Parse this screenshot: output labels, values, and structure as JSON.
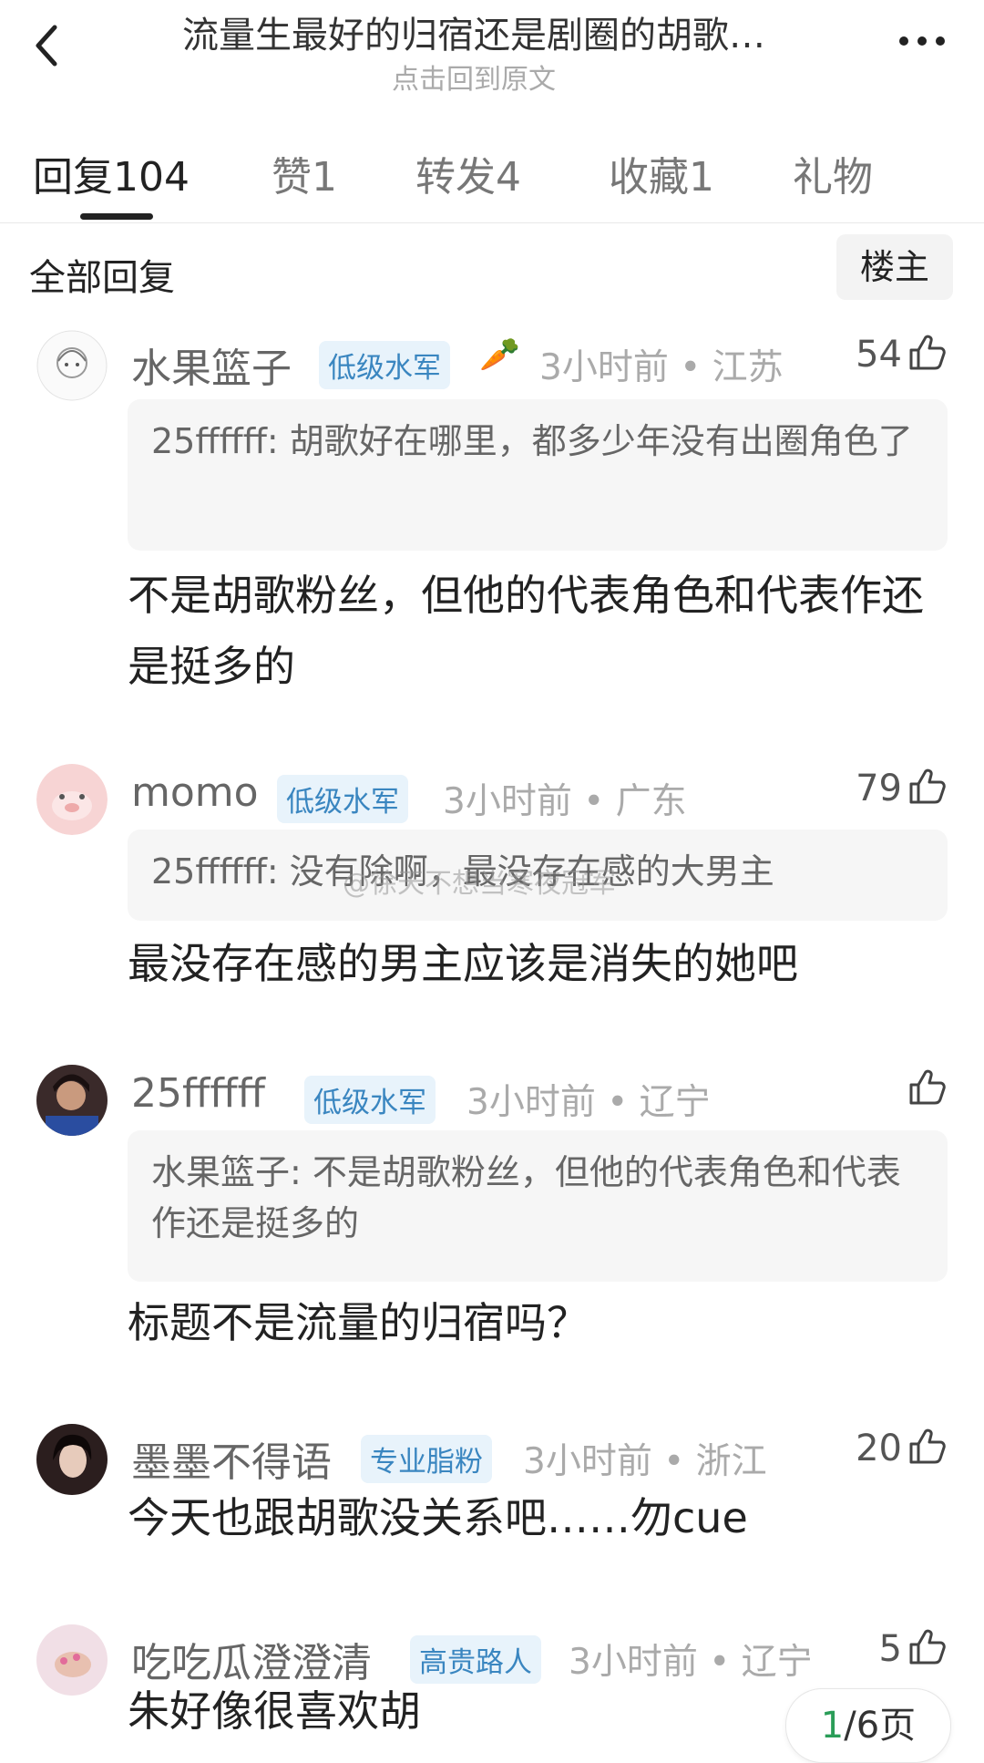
{
  "header": {
    "title": "流量生最好的归宿还是剧圈的胡歌…",
    "subtitle": "点击回到原文"
  },
  "tabs": [
    {
      "label": "回复",
      "count": "104"
    },
    {
      "label": "赞",
      "count": "1"
    },
    {
      "label": "转发",
      "count": "4"
    },
    {
      "label": "收藏",
      "count": "1"
    },
    {
      "label": "礼物",
      "count": ""
    }
  ],
  "section": {
    "title": "全部回复",
    "op_filter": "楼主"
  },
  "comments": [
    {
      "user": "水果篮子",
      "badge": "低级水军",
      "emoji": "🥕",
      "time": "3小时前 • 江苏",
      "likes": "54",
      "quote": "25ffffff: 胡歌好在哪里，都多少年没有出圈角色了",
      "text": "不是胡歌粉丝，但他的代表角色和代表作还是挺多的"
    },
    {
      "user": "momo",
      "badge": "低级水军",
      "emoji": "",
      "time": "3小时前 • 广东",
      "likes": "79",
      "quote": "25ffffff: 没有除啊，最没存在感的大男主",
      "text": "最没存在感的男主应该是消失的她吧"
    },
    {
      "user": "25ffffff",
      "badge": "低级水军",
      "emoji": "",
      "time": "3小时前 • 辽宁",
      "likes": "",
      "quote": "水果篮子: 不是胡歌粉丝，但他的代表角色和代表作还是挺多的",
      "text": "标题不是流量的归宿吗？"
    },
    {
      "user": "墨墨不得语",
      "badge": "专业脂粉",
      "emoji": "",
      "time": "3小时前 • 浙江",
      "likes": "20",
      "quote": "",
      "text": "今天也跟胡歌没关系吧……勿cue"
    },
    {
      "user": "吃吃瓜澄澄清",
      "badge": "高贵路人",
      "emoji": "",
      "time": "3小时前 • 辽宁",
      "likes": "5",
      "quote": "",
      "text": "朱好像很喜欢胡"
    }
  ],
  "watermark": "@徐天不想当寒夜冠军",
  "pager": {
    "current": "1",
    "total": "/6页"
  },
  "colors": {
    "badge_bg": "#e8f3fb",
    "badge_text": "#3a86c0",
    "pager_current": "#2a9d58"
  }
}
